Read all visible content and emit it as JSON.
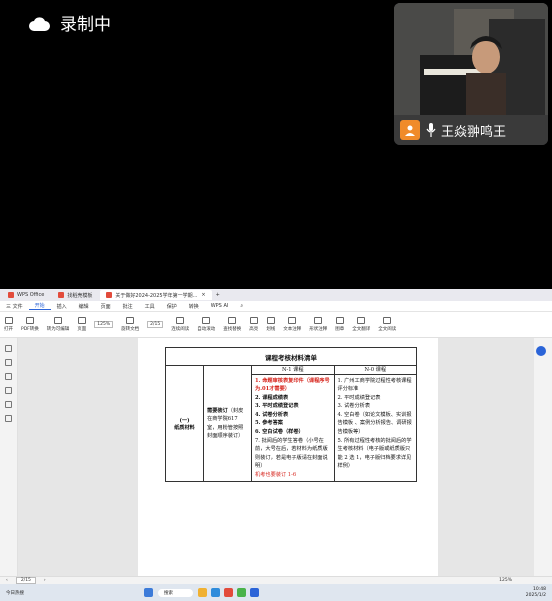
{
  "recording": {
    "label": "录制中"
  },
  "video": {
    "participant_name": "王焱翀鸣王"
  },
  "tabs": [
    {
      "label": "WPS Office",
      "color": "#e24b3b"
    },
    {
      "label": "找稻壳模板",
      "color": "#e24b3b"
    },
    {
      "label": "关于做好2024-2025学年第一学期...",
      "color": "#e24b3b",
      "active": true
    }
  ],
  "menu": {
    "file": "三 文件",
    "items": [
      "开始",
      "插入",
      "编辑",
      "页面",
      "批注",
      "工具",
      "保护",
      "转换",
      "WPS AI"
    ],
    "active_index": 0
  },
  "toolbar": {
    "buttons": [
      "打开",
      "PDF转换",
      "转为可编辑",
      "页面",
      "显示方式",
      "旋转文档",
      "单页",
      "双页",
      "连续阅读",
      "自动滚动",
      "播放",
      "截图和对比",
      "查找替换",
      "高亮",
      "划线",
      "文本注释",
      "形状注释",
      "图章",
      "全文翻译",
      "全文阅读"
    ],
    "zoom": "125%",
    "page_input": "2/15"
  },
  "document": {
    "title": "课程考核材料清单",
    "header_n1": "N-1 课程",
    "header_n0": "N-0 课程",
    "row_label": "(一)\n纸质材料",
    "middle_note_bold": "需要装订",
    "middle_note_rest": "（封皮在商学院617室，用粉管按照封面顺序装订）",
    "n1_items": [
      {
        "text": "1. 命题审核表复印件（课程序号为.01才需要）",
        "color": "red"
      },
      {
        "text": "2. 课程成绩表",
        "color": "black"
      },
      {
        "text": "3. 平时成绩登记表",
        "color": "black"
      },
      {
        "text": "4. 试卷分析表",
        "color": "black"
      },
      {
        "text": "5. 参考答案",
        "color": "black"
      },
      {
        "text": "6. 空白试卷（样卷）",
        "color": "black"
      },
      {
        "text": "7. 批阅后的学生答卷（小号在前，大号在后，若材料为纸质版则装订，若是电子版请在封面说明）",
        "color": "black"
      },
      {
        "text": "机考也要装订 1-6",
        "color": "red"
      }
    ],
    "n0_items": [
      "1. 广州工商学院过程性考核课程评分标准",
      "2. 平时成绩登记表",
      "3. 试卷分析表",
      "4. 空白卷（如论文模板、实训报告模板 、案例分析报告、调研报告模板等）",
      "5. 所有过程性考核的批阅后的学生考核材料（电子版或纸质版只能 2 选 1，电子版归档要求详见样例）"
    ]
  },
  "status": {
    "page": "2/15",
    "zoom": "125%"
  },
  "taskbar": {
    "search": "搜索",
    "time": "10:48",
    "date": "2025/1/2",
    "weather": "今日热搜"
  }
}
